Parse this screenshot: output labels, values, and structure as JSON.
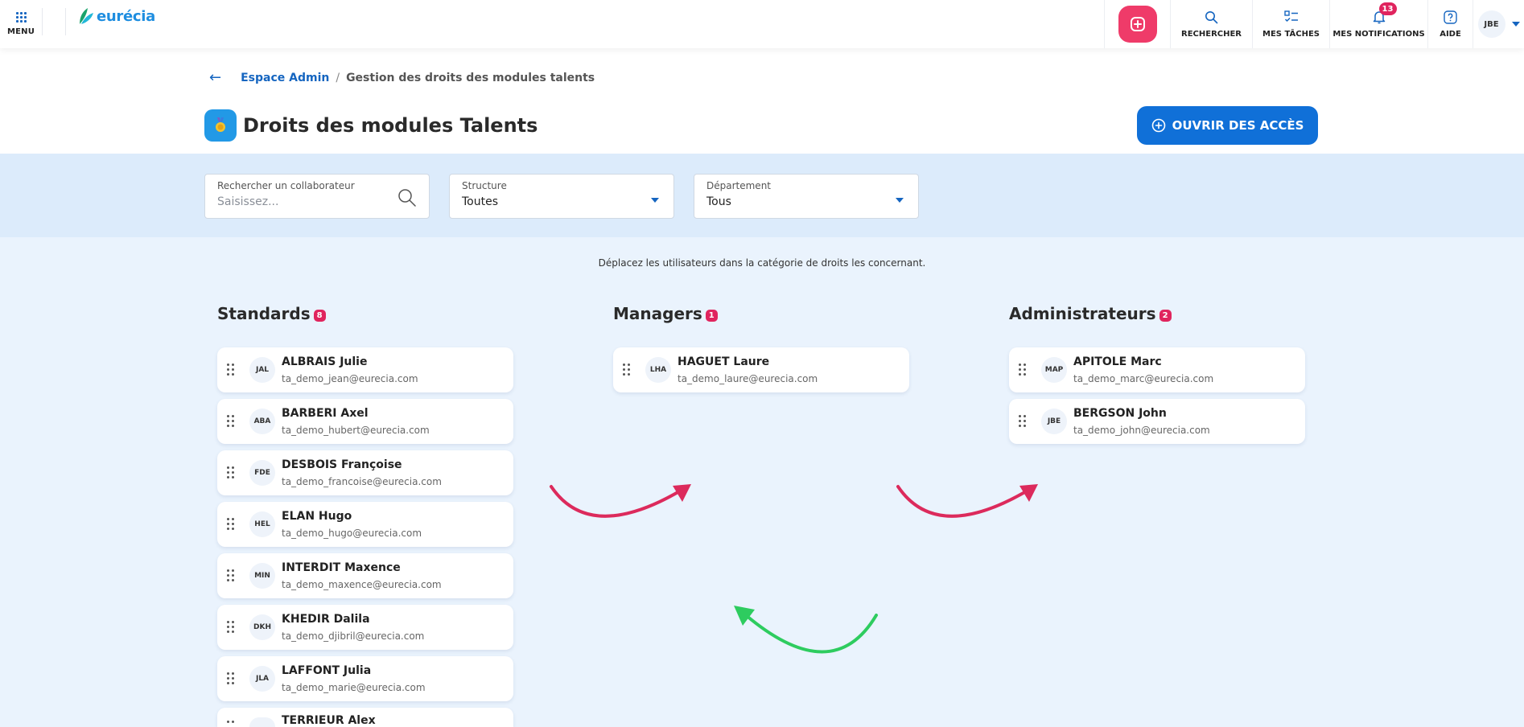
{
  "topbar": {
    "menu_label": "MENU",
    "logo_text": "eurécia",
    "search_label": "RECHERCHER",
    "tasks_label": "MES TÂCHES",
    "notifications_label": "MES NOTIFICATIONS",
    "notifications_count": "13",
    "help_label": "AIDE",
    "user_initials": "JBE",
    "icons": {
      "menu": "grid-icon",
      "add": "plus-circle-icon",
      "search": "search-icon",
      "tasks": "checklist-icon",
      "notifications": "bell-icon",
      "help": "question-icon"
    }
  },
  "breadcrumb": {
    "back_icon": "←",
    "parent": "Espace Admin",
    "separator": "/",
    "current": "Gestion des droits des modules talents"
  },
  "page": {
    "title": "Droits des modules Talents",
    "open_access_label": "OUVRIR DES ACCÈS"
  },
  "filters": {
    "search": {
      "label": "Rechercher un collaborateur",
      "placeholder": "Saisissez...",
      "value": ""
    },
    "structure": {
      "label": "Structure",
      "value": "Toutes"
    },
    "department": {
      "label": "Département",
      "value": "Tous"
    }
  },
  "hint": "Déplacez les utilisateurs dans la catégorie de droits les concernant.",
  "columns": {
    "standards": {
      "title": "Standards",
      "count": "8",
      "users": [
        {
          "initials": "JAL",
          "name": "ALBRAIS Julie",
          "email": "ta_demo_jean@eurecia.com"
        },
        {
          "initials": "ABA",
          "name": "BARBERI Axel",
          "email": "ta_demo_hubert@eurecia.com"
        },
        {
          "initials": "FDE",
          "name": "DESBOIS Françoise",
          "email": "ta_demo_francoise@eurecia.com"
        },
        {
          "initials": "HEL",
          "name": "ELAN Hugo",
          "email": "ta_demo_hugo@eurecia.com"
        },
        {
          "initials": "MIN",
          "name": "INTERDIT Maxence",
          "email": "ta_demo_maxence@eurecia.com"
        },
        {
          "initials": "DKH",
          "name": "KHEDIR Dalila",
          "email": "ta_demo_djibril@eurecia.com"
        },
        {
          "initials": "JLA",
          "name": "LAFFONT Julia",
          "email": "ta_demo_marie@eurecia.com"
        },
        {
          "initials": "",
          "name": "TERRIEUR Alex",
          "email": ""
        }
      ]
    },
    "managers": {
      "title": "Managers",
      "count": "1",
      "users": [
        {
          "initials": "LHA",
          "name": "HAGUET Laure",
          "email": "ta_demo_laure@eurecia.com"
        }
      ]
    },
    "administrateurs": {
      "title": "Administrateurs",
      "count": "2",
      "users": [
        {
          "initials": "MAP",
          "name": "APITOLE Marc",
          "email": "ta_demo_marc@eurecia.com"
        },
        {
          "initials": "JBE",
          "name": "BERGSON John",
          "email": "ta_demo_john@eurecia.com"
        }
      ]
    }
  },
  "colors": {
    "accent": "#1070d8",
    "badge": "#e0245e",
    "arrow_forward": "#dc2a5c",
    "arrow_back": "#2ecc5f",
    "background": "#eaf3fd"
  }
}
